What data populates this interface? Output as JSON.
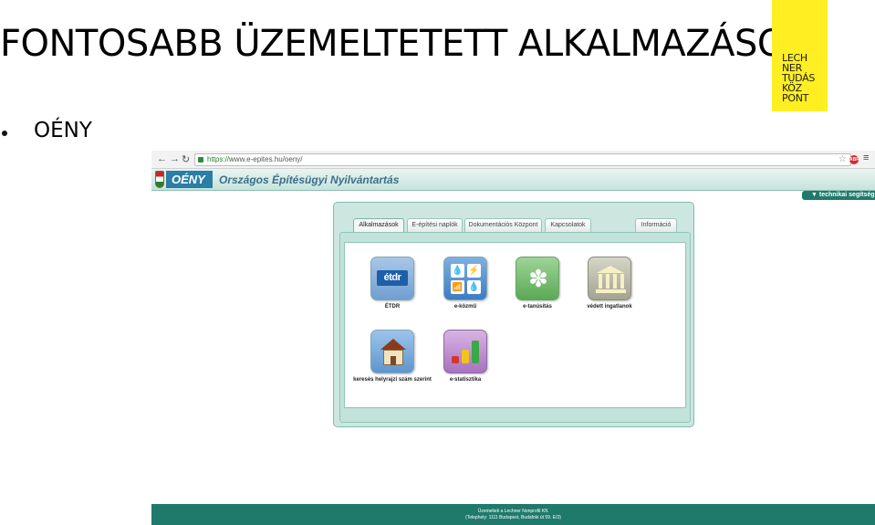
{
  "slide": {
    "title": "FONTOSABB ÜZEMELTETETT ALKALMAZÁSOK",
    "bullet": "OÉNY",
    "logo_lines": "LECH\nNER\nTUDÁS\nKÖZ\nPONT"
  },
  "browser": {
    "url_https": "https://",
    "url_rest": "www.e-epites.hu/oeny/",
    "badge": "ABP"
  },
  "site": {
    "logo_text": "OÉNY",
    "title": "Országos Építésügyi Nyilvántartás",
    "help_label": "▼ technikai segítség",
    "tabs": [
      "Alkalmazások",
      "E-építési naplók",
      "Dokumentációs Központ",
      "Kapcsolatok",
      "Információ"
    ],
    "apps": [
      {
        "label": "ÉTDR",
        "icon_text": "étdr",
        "icon": "etdr-icon"
      },
      {
        "label": "e-közmű",
        "icon": "utilities-icon"
      },
      {
        "label": "e-tanúsítás",
        "icon": "certificate-flower-icon"
      },
      {
        "label": "védett ingatlanok",
        "icon": "protected-building-icon"
      },
      {
        "label": "keresés helyrajzi szám szerint",
        "icon": "house-search-icon"
      },
      {
        "label": "e-statisztika",
        "icon": "statistics-chart-icon"
      }
    ],
    "footer_line1": "Üzemelteti a Lechner Nonprofit Kft.",
    "footer_line2": "(Telephely: 1111 Budapest, Budafoki út 59. E/3)"
  },
  "colors": {
    "accent": "#1f7a6b",
    "logo_yellow": "#ffee22",
    "header_blue": "#2b7ea5"
  }
}
